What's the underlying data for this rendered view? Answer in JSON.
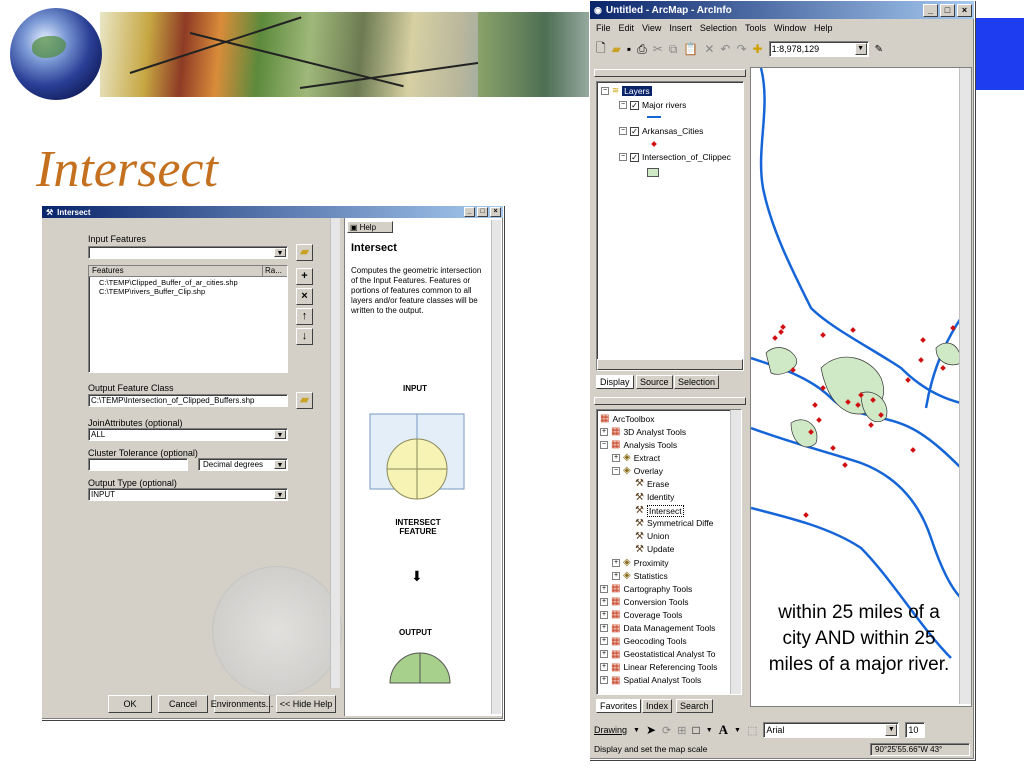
{
  "slide": {
    "title": "Intersect"
  },
  "intersect_dialog": {
    "title": "Intersect",
    "input_features_label": "Input Features",
    "features_column": "Features",
    "rank_column": "Ra...",
    "feature_rows": [
      "C:\\TEMP\\Clipped_Buffer_of_ar_cities.shp",
      "C:\\TEMP\\rivers_Buffer_Clip.shp"
    ],
    "output_label": "Output Feature Class",
    "output_value": "C:\\TEMP\\Intersection_of_Clipped_Buffers.shp",
    "join_label": "JoinAttributes (optional)",
    "join_value": "ALL",
    "cluster_label": "Cluster Tolerance (optional)",
    "cluster_value": "",
    "cluster_units": "Decimal degrees",
    "output_type_label": "Output Type (optional)",
    "output_type_value": "INPUT",
    "ok_label": "OK",
    "cancel_label": "Cancel",
    "env_label": "Environments...",
    "hide_help_label": "<< Hide Help",
    "help": {
      "tab_label": "Help",
      "heading": "Intersect",
      "body": "Computes the geometric intersection of the Input Features. Features or portions of features common to all layers and/or feature classes will be written to the output.",
      "input_caption": "INPUT",
      "intersect_caption": "INTERSECT FEATURE",
      "output_caption": "OUTPUT"
    }
  },
  "arcmap": {
    "title": "Untitled - ArcMap - ArcInfo",
    "menu": [
      "File",
      "Edit",
      "View",
      "Insert",
      "Selection",
      "Tools",
      "Window",
      "Help"
    ],
    "scale": "1:8,978,129",
    "layers_label": "Layers",
    "layers": [
      {
        "name": "Major rivers"
      },
      {
        "name": "Arkansas_Cities"
      },
      {
        "name": "Intersection_of_Clippec"
      }
    ],
    "toc_tabs": [
      "Display",
      "Source",
      "Selection"
    ],
    "toolbox_root": "ArcToolbox",
    "toolbox_items": [
      {
        "label": "3D Analyst Tools",
        "kind": "box",
        "level": 0,
        "expander": "+"
      },
      {
        "label": "Analysis Tools",
        "kind": "box",
        "level": 0,
        "expander": "−"
      },
      {
        "label": "Extract",
        "kind": "set",
        "level": 1,
        "expander": "+"
      },
      {
        "label": "Overlay",
        "kind": "set",
        "level": 1,
        "expander": "−"
      },
      {
        "label": "Erase",
        "kind": "tool",
        "level": 2,
        "expander": ""
      },
      {
        "label": "Identity",
        "kind": "tool",
        "level": 2,
        "expander": ""
      },
      {
        "label": "Intersect",
        "kind": "tool",
        "level": 2,
        "expander": "",
        "selected": true
      },
      {
        "label": "Symmetrical Diffe",
        "kind": "tool",
        "level": 2,
        "expander": ""
      },
      {
        "label": "Union",
        "kind": "tool",
        "level": 2,
        "expander": ""
      },
      {
        "label": "Update",
        "kind": "tool",
        "level": 2,
        "expander": ""
      },
      {
        "label": "Proximity",
        "kind": "set",
        "level": 1,
        "expander": "+"
      },
      {
        "label": "Statistics",
        "kind": "set",
        "level": 1,
        "expander": "+"
      },
      {
        "label": "Cartography Tools",
        "kind": "box",
        "level": 0,
        "expander": "+"
      },
      {
        "label": "Conversion Tools",
        "kind": "box",
        "level": 0,
        "expander": "+"
      },
      {
        "label": "Coverage Tools",
        "kind": "box",
        "level": 0,
        "expander": "+"
      },
      {
        "label": "Data Management Tools",
        "kind": "box",
        "level": 0,
        "expander": "+"
      },
      {
        "label": "Geocoding Tools",
        "kind": "box",
        "level": 0,
        "expander": "+"
      },
      {
        "label": "Geostatistical Analyst To",
        "kind": "box",
        "level": 0,
        "expander": "+"
      },
      {
        "label": "Linear Referencing Tools",
        "kind": "box",
        "level": 0,
        "expander": "+"
      },
      {
        "label": "Spatial Analyst Tools",
        "kind": "box",
        "level": 0,
        "expander": "+"
      }
    ],
    "toolbox_tabs": [
      "Favorites",
      "Index",
      "Search"
    ],
    "drawing_label": "Drawing",
    "font_name": "Arial",
    "font_size": "10",
    "status_text": "Display and set the map scale",
    "coords": "90°25'55.66\"W  43°",
    "colors": {
      "river": "#1565d8",
      "city": "#d01010",
      "buffer_fill": "#cfe9c7",
      "buffer_stroke": "#3a3a3a"
    }
  },
  "annotation": {
    "text": "within 25 miles of a city AND within 25 miles of a major river."
  }
}
